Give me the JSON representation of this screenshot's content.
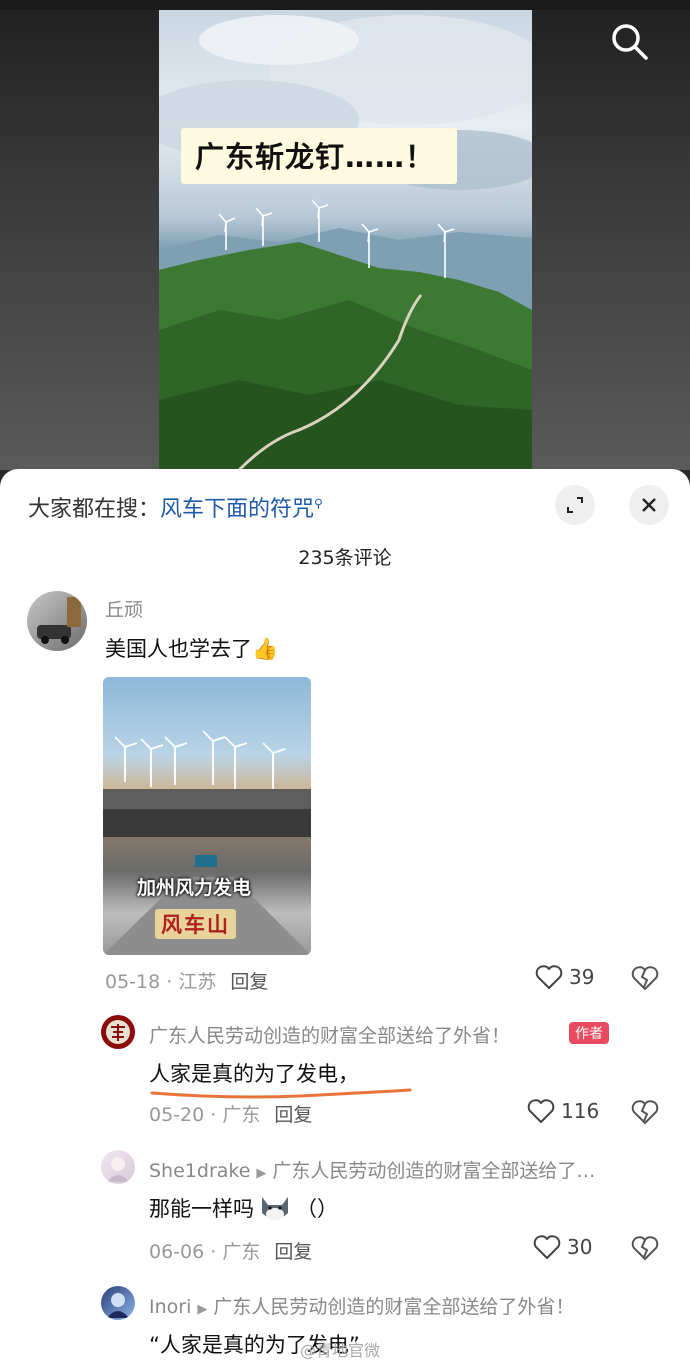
{
  "video": {
    "caption": "广东斩龙钉……！"
  },
  "sheet": {
    "trending_prefix": "大家都在搜：",
    "trending_link": "风车下面的符咒",
    "comment_count": "235条评论"
  },
  "comments": [
    {
      "name": "丘顽",
      "text": "美国人也学去了",
      "emoji": "👍",
      "image_caption_1": "加州风力发电",
      "image_caption_2": "风车山",
      "date": "05-18 · 江苏",
      "reply_label": "回复",
      "likes": "39"
    },
    {
      "name": "广东人民劳动创造的财富全部送给了外省！",
      "badge": "作者",
      "text": "人家是真的为了发电，",
      "date": "05-20 · 广东",
      "reply_label": "回复",
      "likes": "116"
    },
    {
      "name": "She1drake",
      "reply_to": "广东人民劳动创造的财富全部送给了…",
      "text_before": "那能一样吗",
      "text_after": "（）",
      "date": "06-06 · 广东",
      "reply_label": "回复",
      "likes": "30"
    },
    {
      "name": "Inori",
      "reply_to": "广东人民劳动创造的财富全部送给了外省！",
      "text": "“人家是真的为了发电”"
    }
  ],
  "watermark": "@青地官微"
}
